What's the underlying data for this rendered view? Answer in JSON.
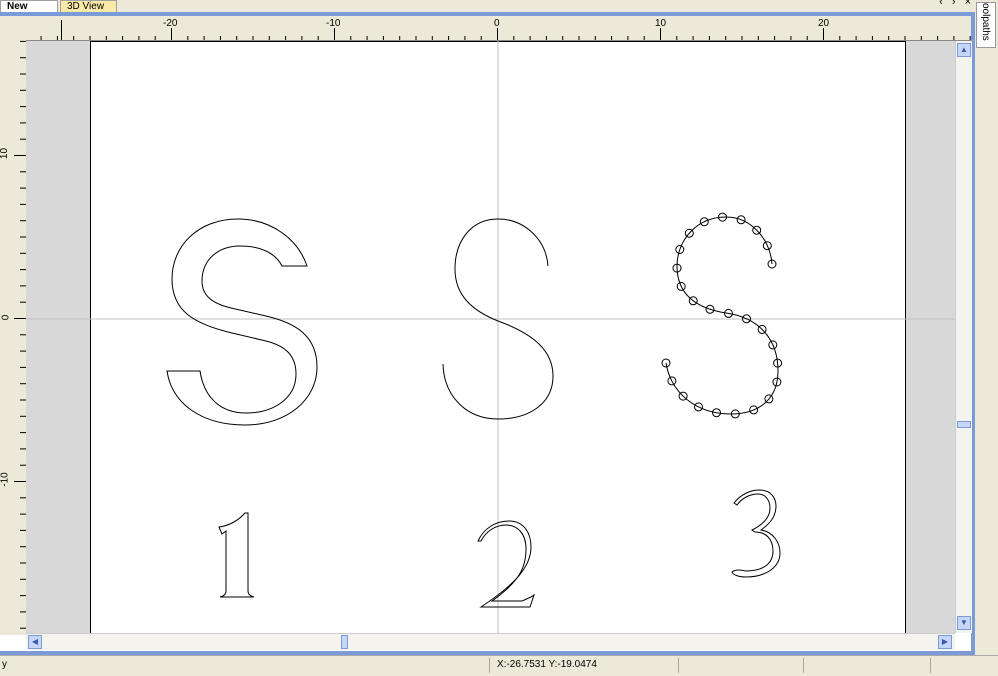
{
  "tabs": {
    "new": "New",
    "view3d": "3D View"
  },
  "window_controls": "‹ › ×",
  "side_panel": {
    "toolpaths_label": "oolpaths"
  },
  "ruler": {
    "horizontal_labels": [
      "-20",
      "-10",
      "0",
      "10",
      "20"
    ],
    "vertical_labels": [
      "10",
      "0",
      "-10"
    ]
  },
  "status": {
    "left_text": "y",
    "coords": "X:-26.7531 Y:-19.0474"
  },
  "icons": {
    "scroll_up": "arrow-up-icon",
    "scroll_down": "arrow-down-icon",
    "scroll_left": "arrow-left-icon",
    "scroll_right": "arrow-right-icon"
  },
  "shapes": [
    "S outline font",
    "S single-line font",
    "S with nodes",
    "1",
    "2",
    "3"
  ],
  "colors": {
    "frame_blue": "#7a9ad8",
    "canvas_gray": "#d8d8d8",
    "tab_3d": "#fbe9a8"
  }
}
